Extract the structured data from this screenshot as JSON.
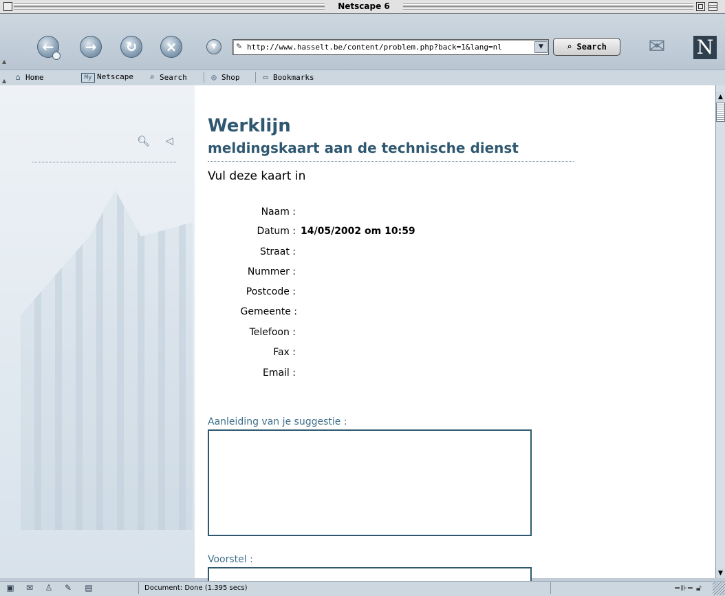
{
  "window": {
    "title": "Netscape 6"
  },
  "navigation": {
    "url": "http://www.hasselt.be/content/problem.php?back=1&lang=nl",
    "search_label": "Search"
  },
  "personal_toolbar": {
    "items": [
      {
        "label": "Home",
        "icon": "home-icon"
      },
      {
        "label": "Netscape",
        "icon": "my-netscape-icon"
      },
      {
        "label": "Search",
        "icon": "search-icon"
      },
      {
        "label": "Shop",
        "icon": "shop-icon"
      },
      {
        "label": "Bookmarks",
        "icon": "bookmarks-folder-icon"
      }
    ],
    "my_badge": "My"
  },
  "page": {
    "title": "Werklijn",
    "subtitle": "meldingskaart aan de technische dienst",
    "instruction": "Vul deze kaart in",
    "fields": [
      {
        "label": "Naam :",
        "value": ""
      },
      {
        "label": "Datum :",
        "value": "14/05/2002 om 10:59"
      },
      {
        "label": "Straat :",
        "value": ""
      },
      {
        "label": "Nummer :",
        "value": ""
      },
      {
        "label": "Postcode :",
        "value": ""
      },
      {
        "label": "Gemeente :",
        "value": ""
      },
      {
        "label": "Telefoon :",
        "value": ""
      },
      {
        "label": "Fax :",
        "value": ""
      },
      {
        "label": "Email :",
        "value": ""
      }
    ],
    "suggestion_label": "Aanleiding van je suggestie :",
    "voorstel_label": "Voorstel :"
  },
  "status": {
    "text": "Document: Done (1.395 secs)"
  },
  "colors": {
    "heading": "#2f5870",
    "label_accent": "#3e6f8b",
    "chrome": "#cdd7e0"
  }
}
